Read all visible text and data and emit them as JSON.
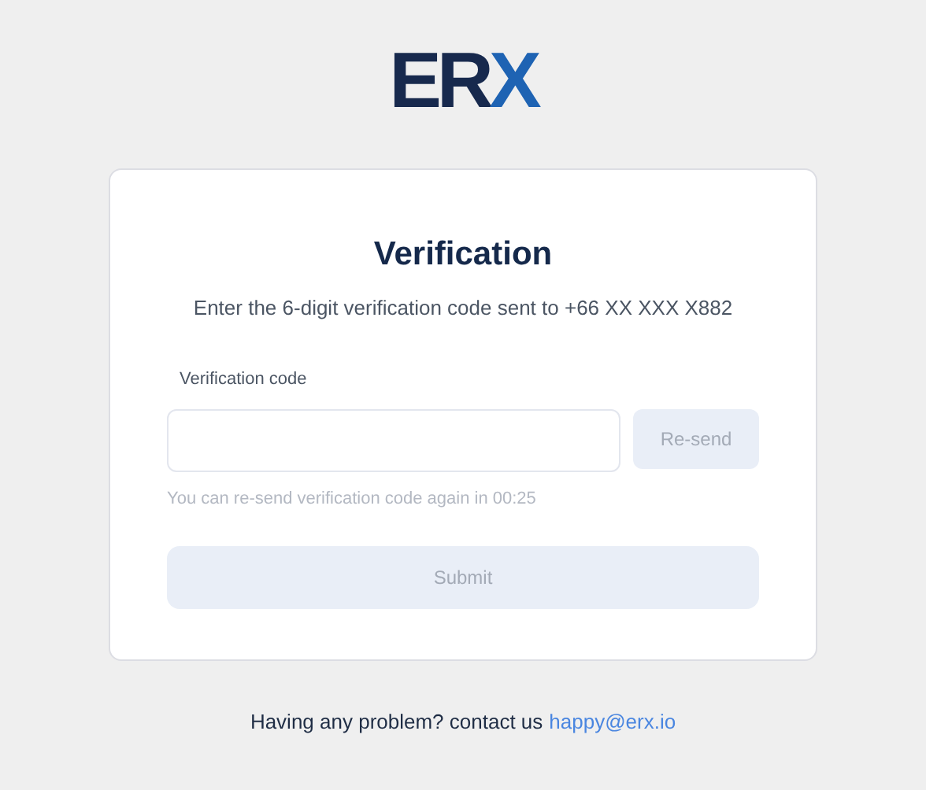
{
  "logo": {
    "main": "ER",
    "accent": "X"
  },
  "card": {
    "title": "Verification",
    "subtitle": "Enter the 6-digit verification code sent to +66 XX XXX X882",
    "field": {
      "label": "Verification code"
    },
    "resend": {
      "label": "Re-send",
      "disabled": true
    },
    "countdown": "You can re-send verification code again in 00:25",
    "submit": {
      "label": "Submit",
      "disabled": true
    }
  },
  "footer": {
    "text": "Having any problem? contact us",
    "link": "happy@erx.io"
  }
}
